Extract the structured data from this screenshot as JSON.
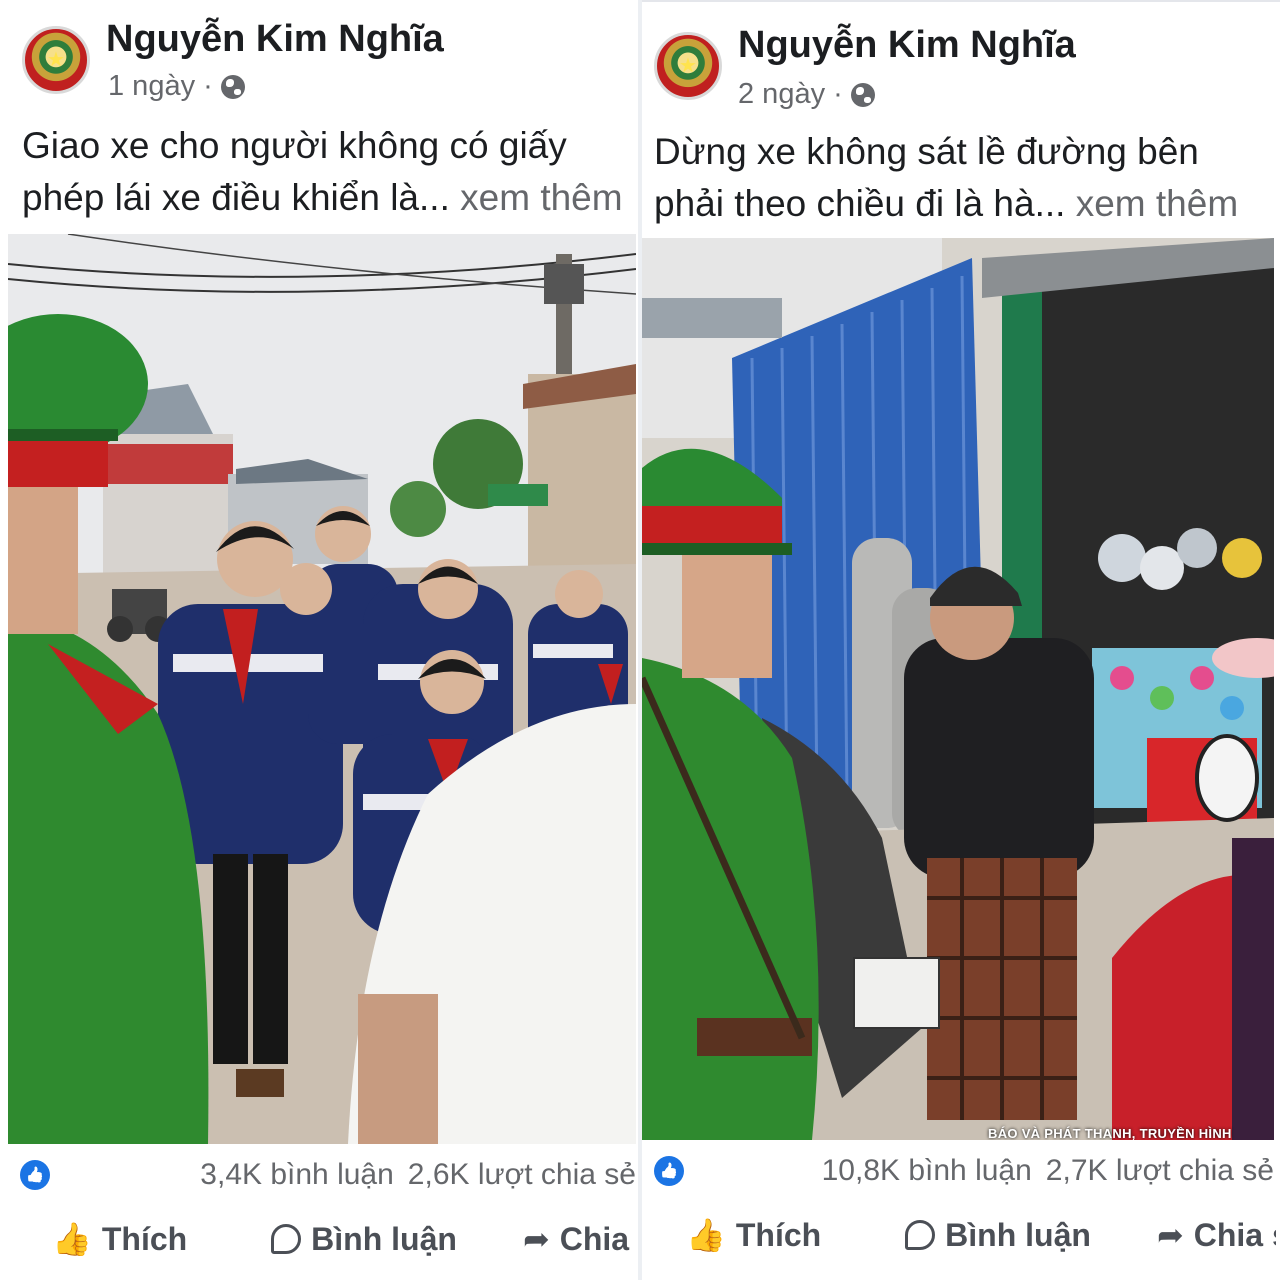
{
  "posts": [
    {
      "author": "Nguyễn Kim Nghĩa",
      "time": "1 ngày",
      "separator": "·",
      "caption_line1": "Giao xe cho người không có giấy",
      "caption_line2": "phép lái xe điều khiển là...",
      "see_more": "xem thêm",
      "comments": "3,4K bình luận",
      "shares": "2,6K lượt chia sẻ",
      "actions": {
        "like": "Thích",
        "comment": "Bình luận",
        "share": "Chia sẻ"
      }
    },
    {
      "author": "Nguyễn Kim Nghĩa",
      "time": "2 ngày",
      "separator": "·",
      "caption_line1": "Dừng xe không sát lề đường bên",
      "caption_line2": "phải theo chiều đi là hà...",
      "see_more": "xem thêm",
      "comments": "10,8K bình luận",
      "shares": "2,7K lượt chia sẻ",
      "watermark": "BÁO VÀ PHÁT THANH, TRUYỀN HÌNH",
      "actions": {
        "like": "Thích",
        "comment": "Bình luận",
        "share": "Chia sẻ"
      }
    }
  ],
  "icons": {
    "globe": "globe-icon",
    "like_reaction": "like-reaction-icon",
    "like": "thumbs-up-icon",
    "comment": "comment-bubble-icon",
    "share": "share-arrow-icon"
  },
  "colors": {
    "facebook_blue": "#1b74e4",
    "text": "#1c1e21",
    "muted": "#65676b",
    "police_uniform": "#2f8a2f",
    "police_cap_band": "#c42020"
  }
}
